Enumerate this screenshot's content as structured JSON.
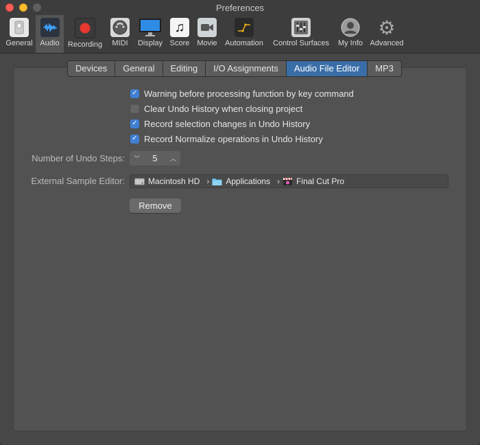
{
  "window": {
    "title": "Preferences"
  },
  "toolbar": {
    "items": [
      {
        "label": "General",
        "icon": "switch-icon"
      },
      {
        "label": "Audio",
        "icon": "waveform-icon",
        "selected": true
      },
      {
        "label": "Recording",
        "icon": "record-icon"
      },
      {
        "label": "MIDI",
        "icon": "midi-port-icon"
      },
      {
        "label": "Display",
        "icon": "monitor-icon"
      },
      {
        "label": "Score",
        "icon": "music-note-icon"
      },
      {
        "label": "Movie",
        "icon": "video-camera-icon"
      },
      {
        "label": "Automation",
        "icon": "automation-curve-icon"
      },
      {
        "label": "Control Surfaces",
        "icon": "faders-icon"
      },
      {
        "label": "My Info",
        "icon": "user-icon"
      },
      {
        "label": "Advanced",
        "icon": "gear-icon"
      }
    ]
  },
  "tabs": [
    {
      "label": "Devices"
    },
    {
      "label": "General"
    },
    {
      "label": "Editing"
    },
    {
      "label": "I/O Assignments"
    },
    {
      "label": "Audio File Editor",
      "active": true
    },
    {
      "label": "MP3"
    }
  ],
  "options": [
    {
      "label": "Warning before processing function by key command",
      "checked": true
    },
    {
      "label": "Clear Undo History when closing project",
      "checked": false
    },
    {
      "label": "Record selection changes in Undo History",
      "checked": true
    },
    {
      "label": "Record Normalize operations in Undo History",
      "checked": true
    }
  ],
  "undo_steps": {
    "label": "Number of Undo Steps:",
    "value": "5"
  },
  "external_editor": {
    "label": "External Sample Editor:",
    "path": [
      "Macintosh HD",
      "Applications",
      "Final Cut Pro"
    ],
    "path_icons": [
      "hard-drive-icon",
      "folder-icon",
      "clapperboard-icon"
    ]
  },
  "remove_button": {
    "label": "Remove"
  },
  "colors": {
    "accent": "#3a6ea8",
    "checkbox_on": "#3f7fd4",
    "record_red": "#e8382f",
    "automation_yellow": "#f0b21a"
  }
}
